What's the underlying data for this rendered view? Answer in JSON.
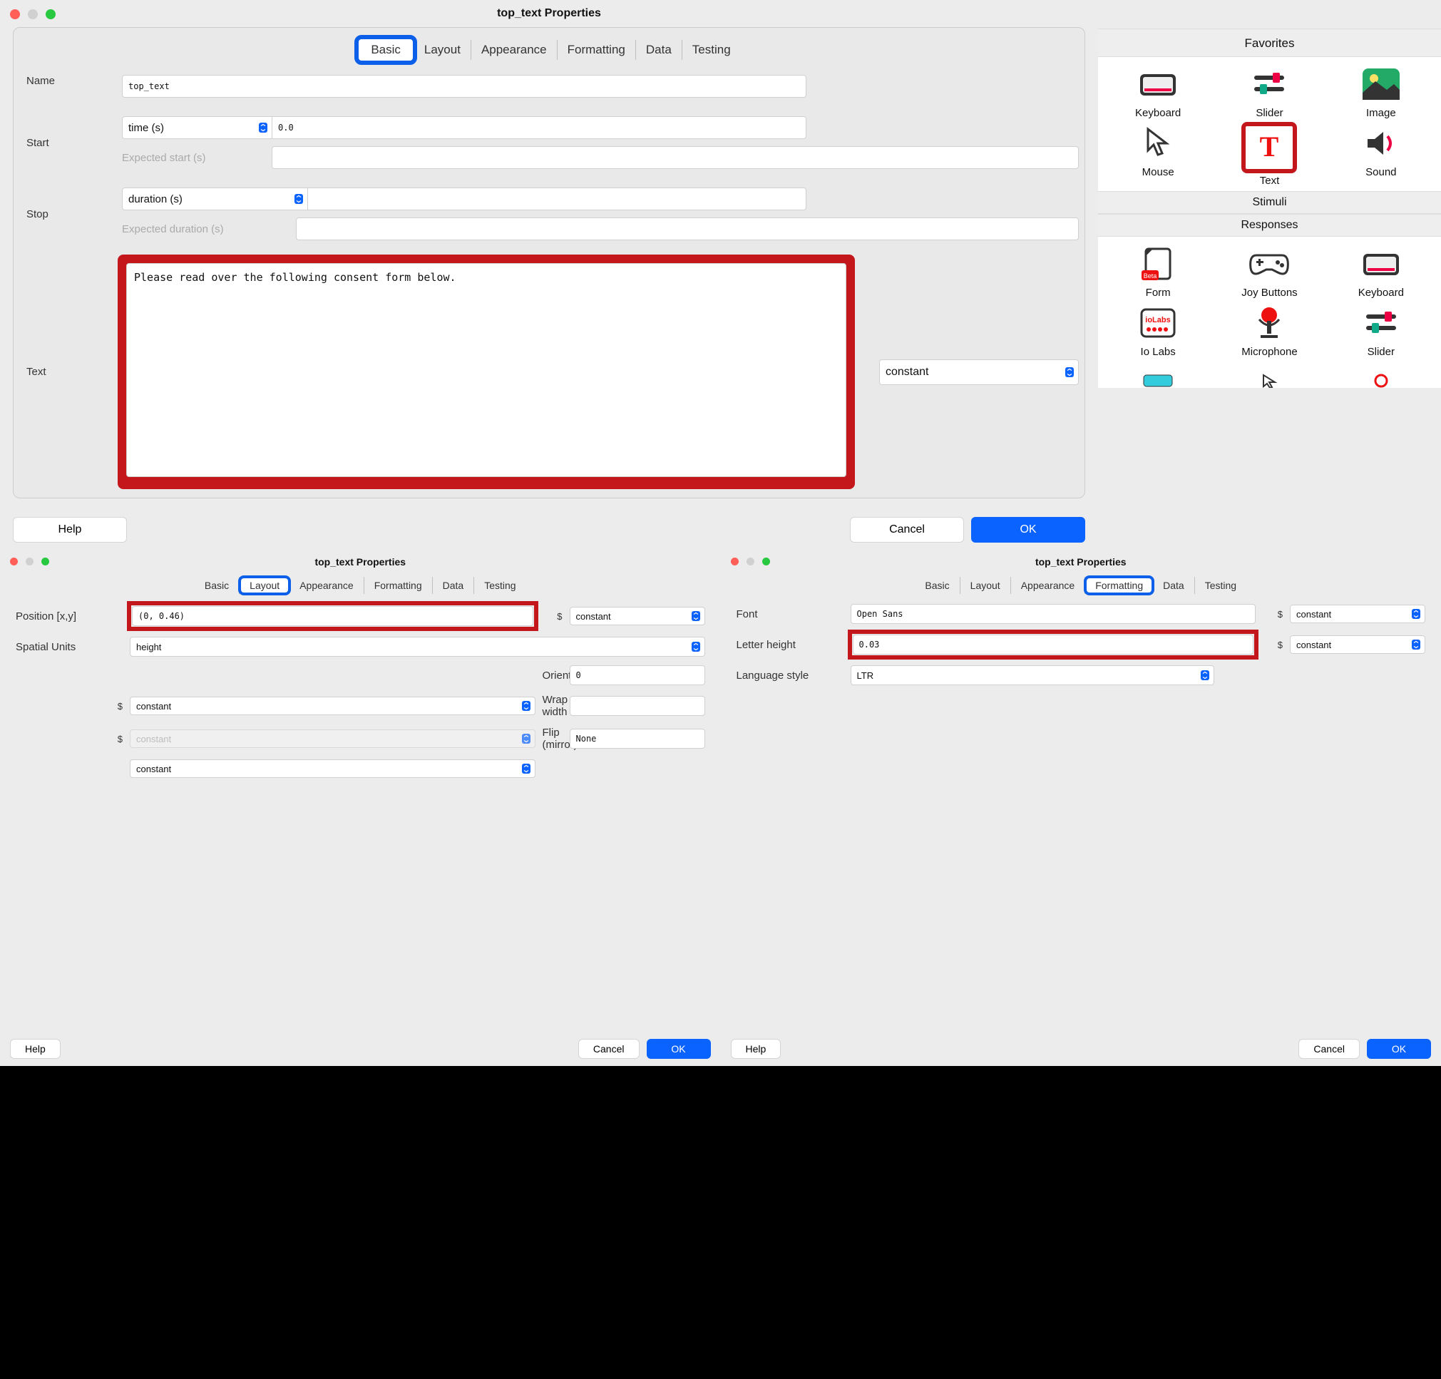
{
  "top": {
    "title": "top_text Properties",
    "tabs": [
      "Basic",
      "Layout",
      "Appearance",
      "Formatting",
      "Data",
      "Testing"
    ],
    "active_tab": 0,
    "name_label": "Name",
    "name_value": "top_text",
    "start_label": "Start",
    "start_mode": "time (s)",
    "start_value": "0.0",
    "expected_start_label": "Expected start (s)",
    "expected_start_value": "",
    "stop_label": "Stop",
    "stop_mode": "duration (s)",
    "stop_value": "",
    "expected_duration_label": "Expected duration (s)",
    "expected_duration_value": "",
    "text_label": "Text",
    "text_value": "Please read over the following consent form below. ",
    "text_const": "constant",
    "help": "Help",
    "cancel": "Cancel",
    "ok": "OK"
  },
  "favorites": {
    "header": "Favorites",
    "row1": [
      {
        "name": "Keyboard",
        "icon": "keyboard"
      },
      {
        "name": "Slider",
        "icon": "slider"
      },
      {
        "name": "Image",
        "icon": "image"
      }
    ],
    "row2": [
      {
        "name": "Mouse",
        "icon": "mouse"
      },
      {
        "name": "Text",
        "icon": "text"
      },
      {
        "name": "Sound",
        "icon": "sound"
      }
    ],
    "stimuli_header": "Stimuli",
    "responses_header": "Responses",
    "resp_row1": [
      {
        "name": "Form",
        "icon": "form"
      },
      {
        "name": "Joy Buttons",
        "icon": "joy"
      },
      {
        "name": "Keyboard",
        "icon": "keyboard"
      }
    ],
    "resp_row2": [
      {
        "name": "Io Labs",
        "icon": "iolabs"
      },
      {
        "name": "Microphone",
        "icon": "mic"
      },
      {
        "name": "Slider",
        "icon": "slider"
      }
    ]
  },
  "layout_win": {
    "title": "top_text Properties",
    "tabs": [
      "Basic",
      "Layout",
      "Appearance",
      "Formatting",
      "Data",
      "Testing"
    ],
    "active_tab": 1,
    "position_label": "Position [x,y]",
    "position_value": "(0, 0.46)",
    "spatial_label": "Spatial Units",
    "spatial_value": "height",
    "orientation_label": "Orientation",
    "orientation_value": "0",
    "wrap_label": "Wrap width",
    "wrap_value": "",
    "flip_label": "Flip (mirror)",
    "flip_value": "None",
    "constant": "constant",
    "help": "Help",
    "cancel": "Cancel",
    "ok": "OK"
  },
  "format_win": {
    "title": "top_text Properties",
    "tabs": [
      "Basic",
      "Layout",
      "Appearance",
      "Formatting",
      "Data",
      "Testing"
    ],
    "active_tab": 3,
    "font_label": "Font",
    "font_value": "Open Sans",
    "height_label": "Letter height",
    "height_value": "0.03",
    "lang_label": "Language style",
    "lang_value": "LTR",
    "constant": "constant",
    "help": "Help",
    "cancel": "Cancel",
    "ok": "OK"
  }
}
